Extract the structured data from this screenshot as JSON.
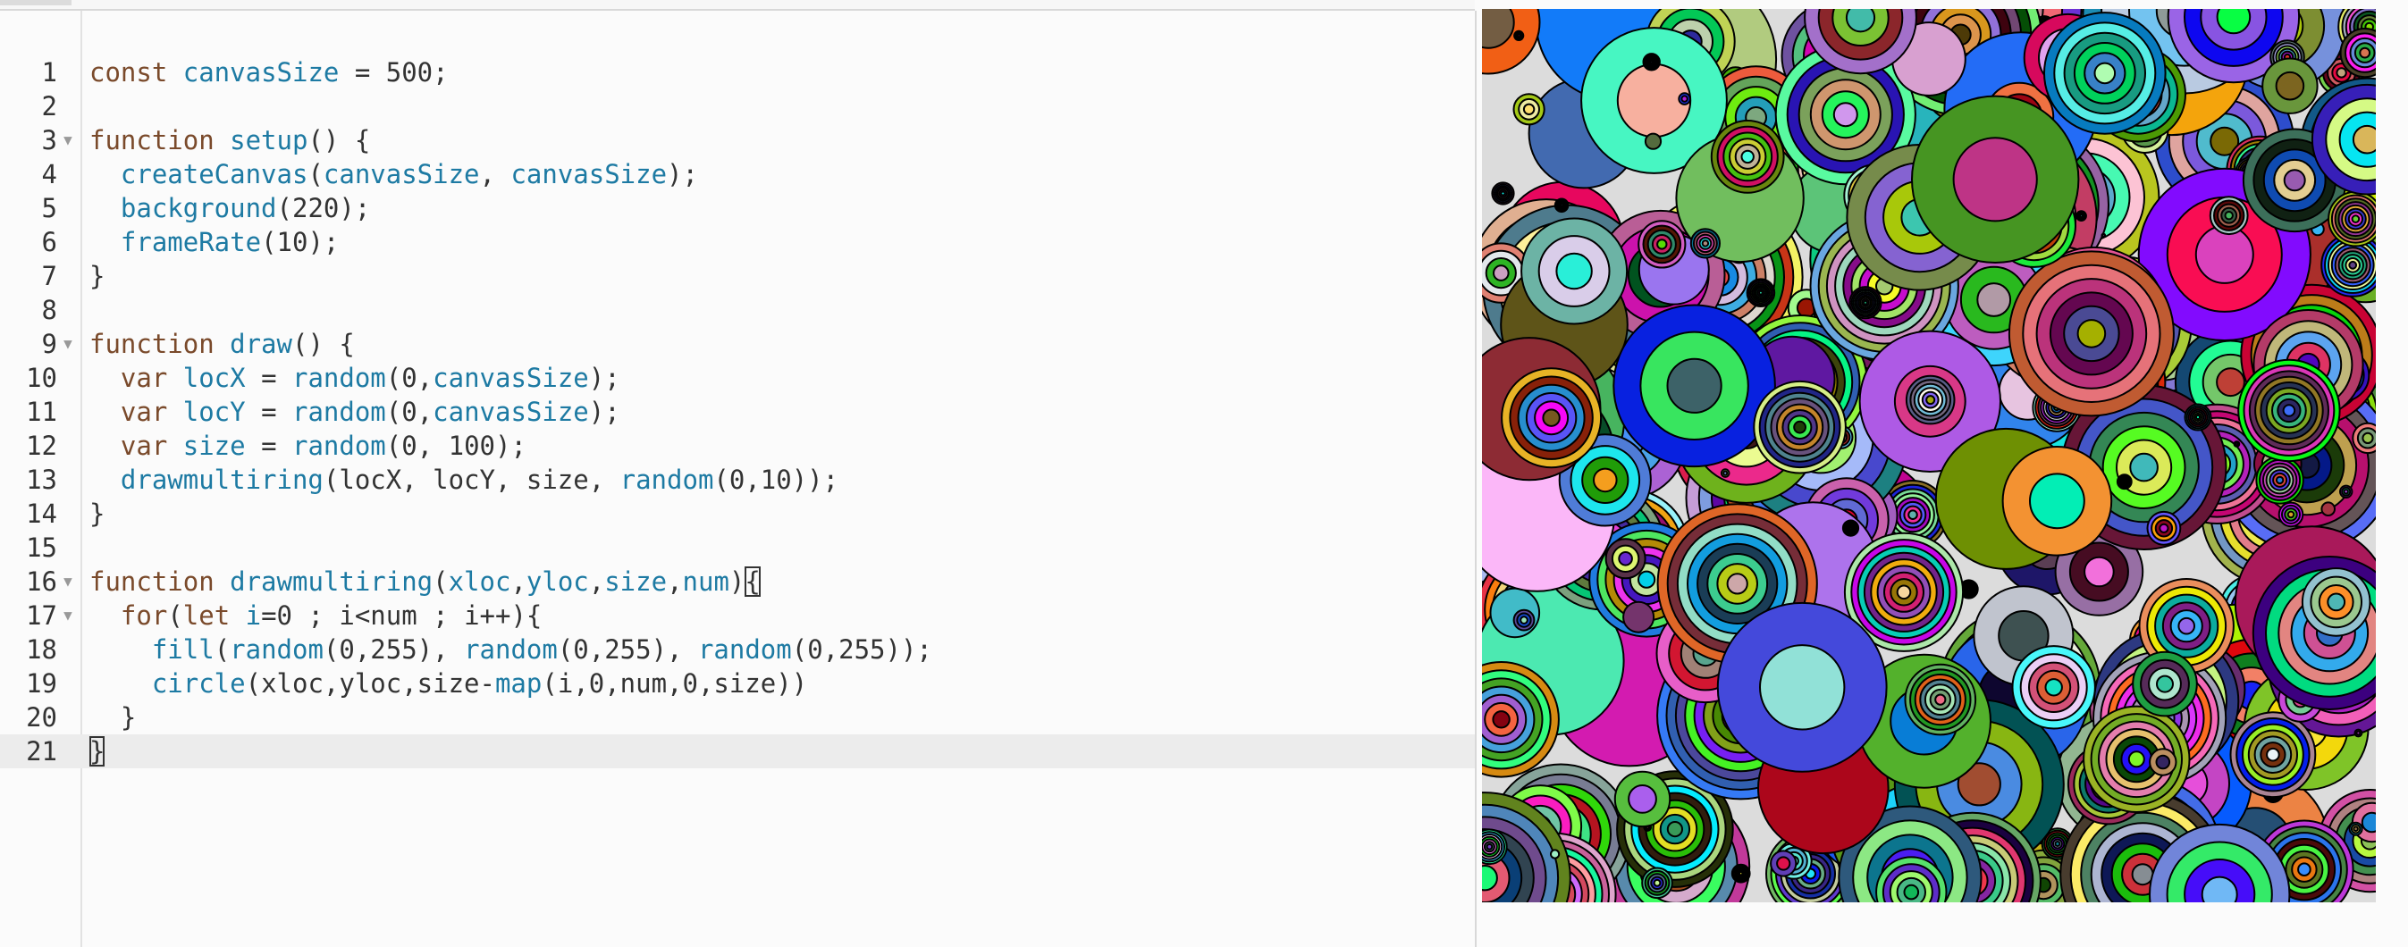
{
  "editor": {
    "lines": [
      {
        "number": "1",
        "fold": false,
        "segments": [
          {
            "t": "const ",
            "c": "kw"
          },
          {
            "t": "canvasSize",
            "c": "fn"
          },
          {
            "t": " = 500;",
            "c": ""
          }
        ]
      },
      {
        "number": "2",
        "fold": false,
        "segments": []
      },
      {
        "number": "3",
        "fold": true,
        "segments": [
          {
            "t": "function ",
            "c": "kw"
          },
          {
            "t": "setup",
            "c": "fn"
          },
          {
            "t": "() {",
            "c": ""
          }
        ]
      },
      {
        "number": "4",
        "fold": false,
        "segments": [
          {
            "t": "  ",
            "c": ""
          },
          {
            "t": "createCanvas",
            "c": "fn"
          },
          {
            "t": "(",
            "c": ""
          },
          {
            "t": "canvasSize",
            "c": "fn"
          },
          {
            "t": ", ",
            "c": ""
          },
          {
            "t": "canvasSize",
            "c": "fn"
          },
          {
            "t": ");",
            "c": ""
          }
        ]
      },
      {
        "number": "5",
        "fold": false,
        "segments": [
          {
            "t": "  ",
            "c": ""
          },
          {
            "t": "background",
            "c": "fn"
          },
          {
            "t": "(220);",
            "c": ""
          }
        ]
      },
      {
        "number": "6",
        "fold": false,
        "segments": [
          {
            "t": "  ",
            "c": ""
          },
          {
            "t": "frameRate",
            "c": "fn"
          },
          {
            "t": "(10);",
            "c": ""
          }
        ]
      },
      {
        "number": "7",
        "fold": false,
        "segments": [
          {
            "t": "}",
            "c": ""
          }
        ]
      },
      {
        "number": "8",
        "fold": false,
        "segments": []
      },
      {
        "number": "9",
        "fold": true,
        "segments": [
          {
            "t": "function ",
            "c": "kw"
          },
          {
            "t": "draw",
            "c": "fn"
          },
          {
            "t": "() {",
            "c": ""
          }
        ]
      },
      {
        "number": "10",
        "fold": false,
        "segments": [
          {
            "t": "  var ",
            "c": "kw"
          },
          {
            "t": "locX",
            "c": "fn"
          },
          {
            "t": " = ",
            "c": ""
          },
          {
            "t": "random",
            "c": "fn"
          },
          {
            "t": "(0,",
            "c": ""
          },
          {
            "t": "canvasSize",
            "c": "fn"
          },
          {
            "t": ");",
            "c": ""
          }
        ]
      },
      {
        "number": "11",
        "fold": false,
        "segments": [
          {
            "t": "  var ",
            "c": "kw"
          },
          {
            "t": "locY",
            "c": "fn"
          },
          {
            "t": " = ",
            "c": ""
          },
          {
            "t": "random",
            "c": "fn"
          },
          {
            "t": "(0,",
            "c": ""
          },
          {
            "t": "canvasSize",
            "c": "fn"
          },
          {
            "t": ");",
            "c": ""
          }
        ]
      },
      {
        "number": "12",
        "fold": false,
        "segments": [
          {
            "t": "  var ",
            "c": "kw"
          },
          {
            "t": "size",
            "c": "fn"
          },
          {
            "t": " = ",
            "c": ""
          },
          {
            "t": "random",
            "c": "fn"
          },
          {
            "t": "(0, 100);",
            "c": ""
          }
        ]
      },
      {
        "number": "13",
        "fold": false,
        "segments": [
          {
            "t": "  ",
            "c": ""
          },
          {
            "t": "drawmultiring",
            "c": "fn"
          },
          {
            "t": "(locX, locY, size, ",
            "c": ""
          },
          {
            "t": "random",
            "c": "fn"
          },
          {
            "t": "(0,10));",
            "c": ""
          }
        ]
      },
      {
        "number": "14",
        "fold": false,
        "segments": [
          {
            "t": "}",
            "c": ""
          }
        ]
      },
      {
        "number": "15",
        "fold": false,
        "segments": []
      },
      {
        "number": "16",
        "fold": true,
        "segments": [
          {
            "t": "function ",
            "c": "kw"
          },
          {
            "t": "drawmultiring",
            "c": "fn"
          },
          {
            "t": "(",
            "c": ""
          },
          {
            "t": "xloc",
            "c": "fn"
          },
          {
            "t": ",",
            "c": ""
          },
          {
            "t": "yloc",
            "c": "fn"
          },
          {
            "t": ",",
            "c": ""
          },
          {
            "t": "size",
            "c": "fn"
          },
          {
            "t": ",",
            "c": ""
          },
          {
            "t": "num",
            "c": "fn"
          },
          {
            "t": ")",
            "c": ""
          },
          {
            "t": "{",
            "c": "bracket-box"
          }
        ]
      },
      {
        "number": "17",
        "fold": true,
        "segments": [
          {
            "t": "  ",
            "c": ""
          },
          {
            "t": "for",
            "c": "kw"
          },
          {
            "t": "(",
            "c": ""
          },
          {
            "t": "let ",
            "c": "kw"
          },
          {
            "t": "i",
            "c": "fn"
          },
          {
            "t": "=0 ; i<num ; i++){",
            "c": ""
          }
        ]
      },
      {
        "number": "18",
        "fold": false,
        "segments": [
          {
            "t": "    ",
            "c": ""
          },
          {
            "t": "fill",
            "c": "fn"
          },
          {
            "t": "(",
            "c": ""
          },
          {
            "t": "random",
            "c": "fn"
          },
          {
            "t": "(0,255), ",
            "c": ""
          },
          {
            "t": "random",
            "c": "fn"
          },
          {
            "t": "(0,255), ",
            "c": ""
          },
          {
            "t": "random",
            "c": "fn"
          },
          {
            "t": "(0,255));",
            "c": ""
          }
        ]
      },
      {
        "number": "19",
        "fold": false,
        "segments": [
          {
            "t": "    ",
            "c": ""
          },
          {
            "t": "circle",
            "c": "fn"
          },
          {
            "t": "(xloc,yloc,size-",
            "c": ""
          },
          {
            "t": "map",
            "c": "fn"
          },
          {
            "t": "(i,0,num,0,size))",
            "c": ""
          }
        ]
      },
      {
        "number": "20",
        "fold": false,
        "segments": [
          {
            "t": "  }",
            "c": ""
          }
        ]
      },
      {
        "number": "21",
        "fold": false,
        "current": true,
        "segments": [
          {
            "t": "}",
            "c": "bracket-box"
          }
        ]
      }
    ]
  },
  "colors": {
    "keyword": "#7a4a2b",
    "identifier": "#1d7aa3",
    "text": "#333333",
    "current_line": "#ececec",
    "canvas_background": "#dcdcdc"
  }
}
